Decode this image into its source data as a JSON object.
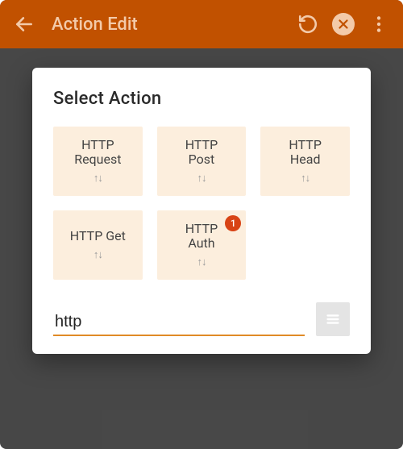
{
  "colors": {
    "appbar_bg": "#c15100",
    "appbar_fg": "#f3caa9",
    "tile_bg": "#fceedd",
    "accent": "#e08a27",
    "badge": "#d84315"
  },
  "appbar": {
    "title": "Action Edit"
  },
  "dialog": {
    "title": "Select  Action",
    "tiles": [
      {
        "label": "HTTP\nRequest",
        "icon": "swap-vert-icon",
        "badge": null
      },
      {
        "label": "HTTP\nPost",
        "icon": "swap-vert-icon",
        "badge": null
      },
      {
        "label": "HTTP\nHead",
        "icon": "swap-vert-icon",
        "badge": null
      },
      {
        "label": "HTTP Get",
        "icon": "swap-vert-icon",
        "badge": null
      },
      {
        "label": "HTTP\nAuth",
        "icon": "swap-vert-icon",
        "badge": "1"
      }
    ],
    "search_value": "http"
  }
}
